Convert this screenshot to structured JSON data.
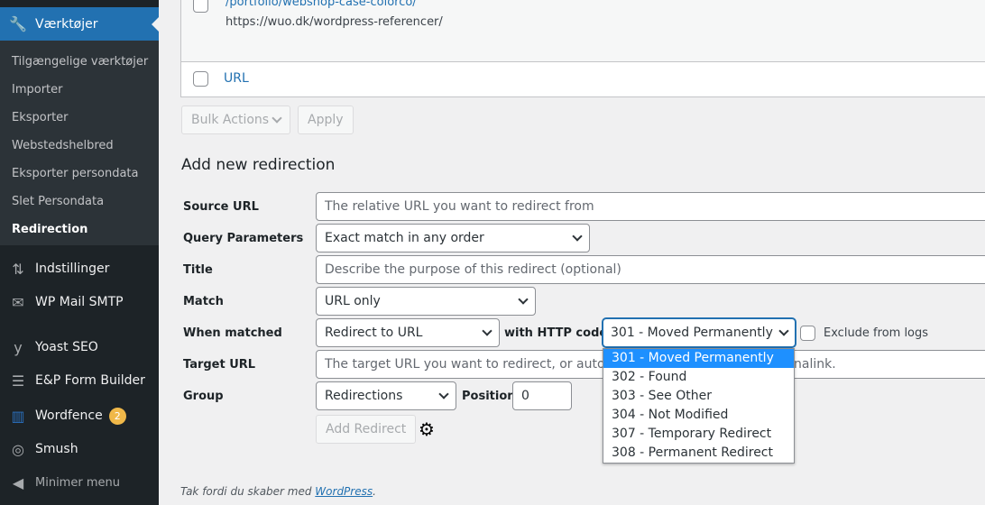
{
  "sidebar": {
    "active": "Værktøjer",
    "submenu": [
      "Tilgængelige værktøjer",
      "Importer",
      "Eksporter",
      "Webstedshelbred",
      "Eksporter persondata",
      "Slet Persondata",
      "Redirection"
    ],
    "menu": [
      {
        "label": "Indstillinger",
        "icon": "settings-icon"
      },
      {
        "label": "WP Mail SMTP",
        "icon": "mail-icon"
      },
      {
        "label": "Yoast SEO",
        "icon": "yoast-icon"
      },
      {
        "label": "E&P Form Builder",
        "icon": "form-icon"
      },
      {
        "label": "Wordfence",
        "icon": "wordfence-icon",
        "badge": "2"
      },
      {
        "label": "Smush",
        "icon": "smush-icon"
      }
    ],
    "collapse": "Minimer menu"
  },
  "table": {
    "source": "/portfolio/webshop-case-colorco/",
    "target": "https://wuo.dk/wordpress-referencer/",
    "footer_col": "URL"
  },
  "bulk": {
    "label": "Bulk Actions",
    "apply": "Apply"
  },
  "form": {
    "heading": "Add new redirection",
    "source_label": "Source URL",
    "source_ph": "The relative URL you want to redirect from",
    "query_label": "Query Parameters",
    "query_value": "Exact match in any order",
    "title_label": "Title",
    "title_ph": "Describe the purpose of this redirect (optional)",
    "match_label": "Match",
    "match_value": "URL only",
    "when_label": "When matched",
    "when_value": "Redirect to URL",
    "http_label": "with HTTP code",
    "http_value": "301 - Moved Permanently",
    "exclude_label": "Exclude from logs",
    "target_label": "Target URL",
    "target_ph_start": "The target URL you want to redirect, or auto-c",
    "target_ph_end": "nalink.",
    "group_label": "Group",
    "group_value": "Redirections",
    "position_label": "Position",
    "position_value": "0",
    "add_button": "Add Redirect",
    "http_options": [
      "301 - Moved Permanently",
      "302 - Found",
      "303 - See Other",
      "304 - Not Modified",
      "307 - Temporary Redirect",
      "308 - Permanent Redirect"
    ]
  },
  "footer": {
    "text": "Tak fordi du skaber med ",
    "link": "WordPress",
    "end": "."
  },
  "colors": {
    "accent": "#2271b1",
    "sidebar": "#1d2327",
    "highlight": "#1e90ff",
    "badge": "#f0b849"
  }
}
